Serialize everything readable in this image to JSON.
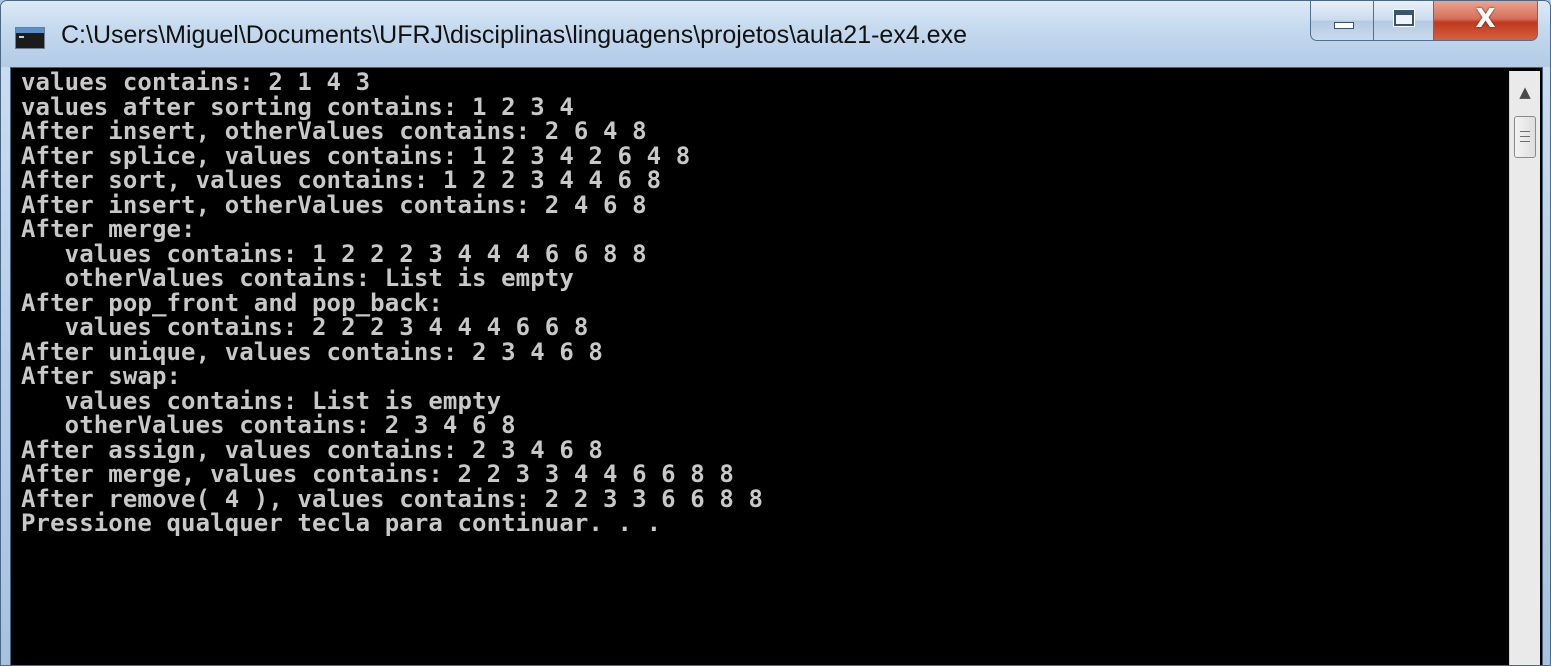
{
  "window": {
    "title": "C:\\Users\\Miguel\\Documents\\UFRJ\\disciplinas\\linguagens\\projetos\\aula21-ex4.exe",
    "icon": "console-icon",
    "buttons": {
      "minimize": "minimize-icon",
      "maximize": "maximize-icon",
      "close_glyph": "X"
    }
  },
  "console": {
    "background": "#000000",
    "text_color": "#c8c8c8",
    "lines": [
      "values contains: 2 1 4 3",
      "values after sorting contains: 1 2 3 4",
      "After insert, otherValues contains: 2 6 4 8",
      "After splice, values contains: 1 2 3 4 2 6 4 8",
      "After sort, values contains: 1 2 2 3 4 4 6 8",
      "After insert, otherValues contains: 2 4 6 8",
      "After merge:",
      "   values contains: 1 2 2 2 3 4 4 4 6 6 8 8",
      "   otherValues contains: List is empty",
      "After pop_front and pop_back:",
      "   values contains: 2 2 2 3 4 4 4 6 6 8",
      "After unique, values contains: 2 3 4 6 8",
      "After swap:",
      "   values contains: List is empty",
      "   otherValues contains: 2 3 4 6 8",
      "After assign, values contains: 2 3 4 6 8",
      "After merge, values contains: 2 2 3 3 4 4 6 6 8 8",
      "After remove( 4 ), values contains: 2 2 3 3 6 6 8 8",
      "Pressione qualquer tecla para continuar. . ."
    ]
  },
  "scrollbar": {
    "up_arrow": "▲",
    "thumb": "scroll-thumb-grip"
  }
}
